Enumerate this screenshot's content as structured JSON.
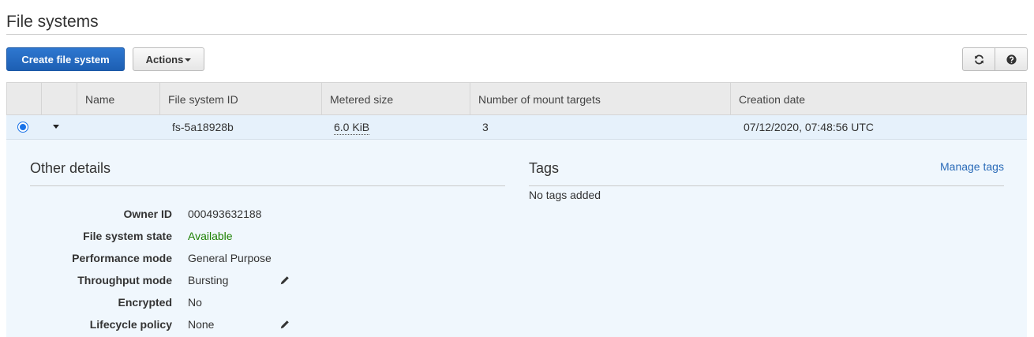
{
  "page": {
    "title": "File systems"
  },
  "toolbar": {
    "create_label": "Create file system",
    "actions_label": "Actions",
    "refresh_icon": "refresh-icon",
    "help_icon": "help-icon"
  },
  "table": {
    "columns": [
      "Name",
      "File system ID",
      "Metered size",
      "Number of mount targets",
      "Creation date"
    ],
    "rows": [
      {
        "selected": true,
        "name": "",
        "id": "fs-5a18928b",
        "metered_size": "6.0 KiB",
        "mount_targets": "3",
        "creation_date": "07/12/2020, 07:48:56 UTC"
      }
    ]
  },
  "details": {
    "other_title": "Other details",
    "fields": [
      {
        "label": "Owner ID",
        "value": "000493632188"
      },
      {
        "label": "File system state",
        "value": "Available"
      },
      {
        "label": "Performance mode",
        "value": "General Purpose"
      },
      {
        "label": "Throughput mode",
        "value": "Bursting"
      },
      {
        "label": "Encrypted",
        "value": "No"
      },
      {
        "label": "Lifecycle policy",
        "value": "None"
      }
    ],
    "tags_title": "Tags",
    "manage_tags_label": "Manage tags",
    "no_tags_text": "No tags added"
  },
  "colors": {
    "primary": "#1d5fb3",
    "selected_row": "#e6f1fb",
    "available": "#1d8102",
    "link": "#2a6bb8"
  }
}
